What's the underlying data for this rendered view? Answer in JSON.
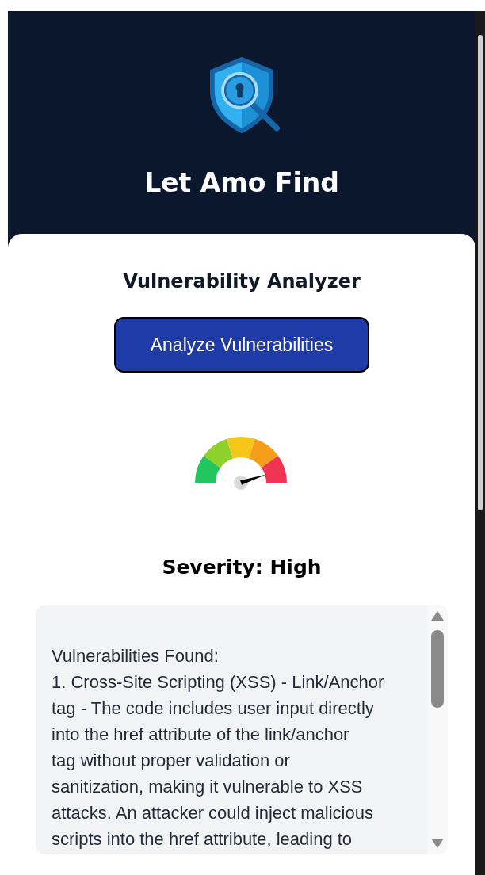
{
  "header": {
    "title": "Let Amo Find"
  },
  "card": {
    "title": "Vulnerability Analyzer",
    "button": "Analyze Vulnerabilities",
    "severity": "Severity: High",
    "results": {
      "lines": [
        "Vulnerabilities Found:",
        "1. Cross-Site Scripting (XSS) - Link/Anchor",
        "tag - The code includes user input directly",
        "into the href attribute of the link/anchor",
        "tag without proper validation or",
        "sanitization, making it vulnerable to XSS",
        "attacks. An attacker could inject malicious",
        "scripts into the href attribute, leading to"
      ]
    }
  }
}
